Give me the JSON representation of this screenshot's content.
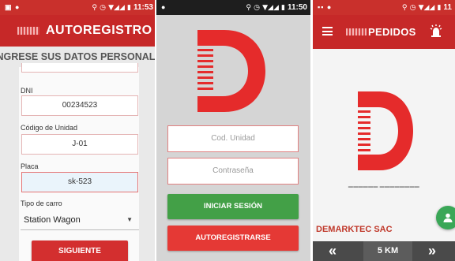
{
  "colors": {
    "brand_red": "#c62828",
    "button_green": "#43a047",
    "button_red": "#e53935",
    "fab_green": "#3aa757",
    "bottom_bar": "#4a4a4a"
  },
  "registration": {
    "status_time": "11:53",
    "app_title": "AUTOREGISTRO",
    "banner": "INGRESE SUS DATOS PERSONALES",
    "fields": [
      {
        "label": "DNI",
        "value": "00234523"
      },
      {
        "label": "Código de Unidad",
        "value": "J-01"
      },
      {
        "label": "Placa",
        "value": "sk-523"
      }
    ],
    "car_type_label": "Tipo de carro",
    "car_type_value": "Station Wagon",
    "next_button": "SIGUIENTE"
  },
  "login": {
    "status_time": "11:50",
    "unit_code_placeholder": "Cod. Unidad",
    "password_placeholder": "Contraseña",
    "login_button": "INICIAR SESIÓN",
    "register_button": "AUTOREGISTRARSE"
  },
  "orders": {
    "status_time": "11",
    "app_title": "PEDIDOS",
    "company": "DEMARKTEC SAC",
    "distance": "5 KM",
    "icons": [
      "menu-icon",
      "alarm-icon",
      "person-icon",
      "chevron-left-double-icon",
      "chevron-right-double-icon"
    ]
  }
}
